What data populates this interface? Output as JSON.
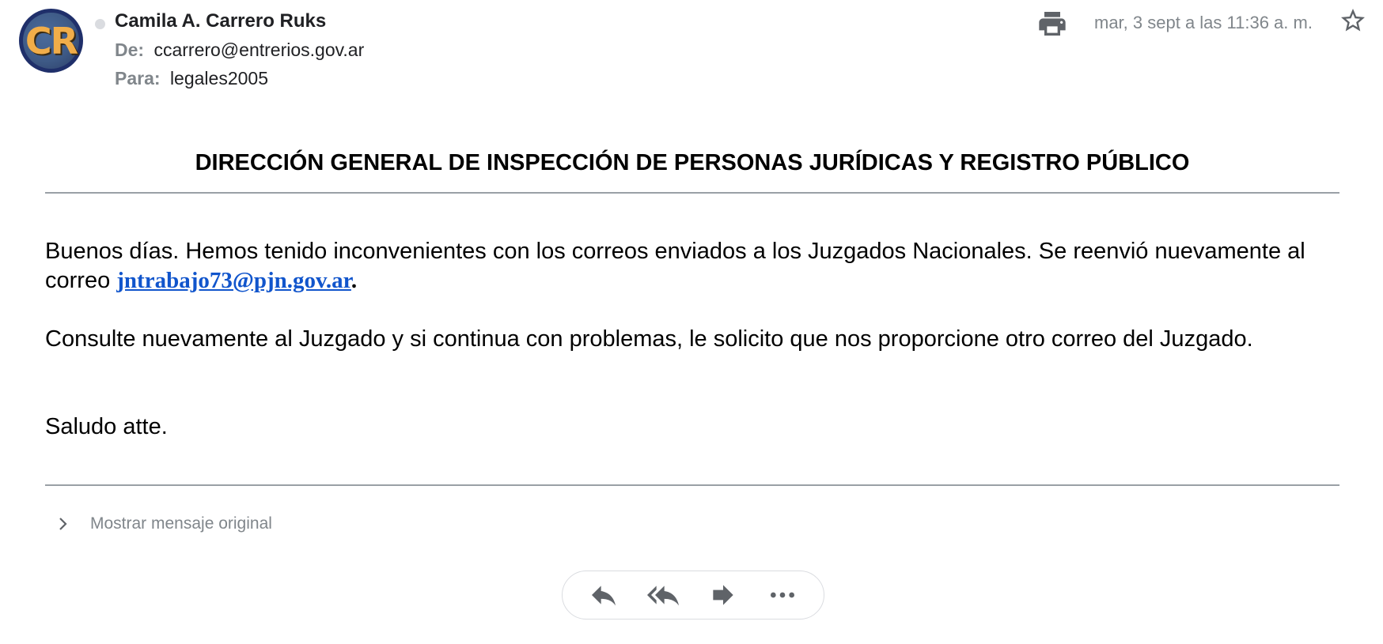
{
  "email": {
    "sender_name": "Camila A. Carrero Ruks",
    "avatar_initials": "CR",
    "from_label": "De:",
    "from_address": "ccarrero@entrerios.gov.ar",
    "to_label": "Para:",
    "to_address": "legales2005",
    "date": "mar, 3 sept a las 11:36 a. m."
  },
  "body": {
    "heading": "DIRECCIÓN GENERAL DE INSPECCIÓN DE PERSONAS JURÍDICAS Y REGISTRO PÚBLICO",
    "p1_text": "Buenos días. Hemos tenido inconvenientes con los correos enviados a los Juzgados Nacionales. Se reenvió nuevamente al correo ",
    "p1_link": "jntrabajo73@pjn.gov.ar",
    "p1_end": ".",
    "p2": "Consulte nuevamente al Juzgado y si continua con problemas, le solicito que nos proporcione otro correo del Juzgado.",
    "p3": "Saludo atte."
  },
  "footer": {
    "show_original": "Mostrar mensaje original"
  },
  "icons": {
    "print": "print-icon",
    "star": "star-outline-icon",
    "reply": "reply-icon",
    "reply_all": "reply-all-icon",
    "forward": "forward-icon",
    "more": "more-horizontal-icon",
    "chevron": "chevron-right-icon"
  },
  "colors": {
    "link": "#1155cc",
    "secondary_text": "#80868b",
    "icon": "#5f6368",
    "avatar_text": "#f1ad49"
  }
}
